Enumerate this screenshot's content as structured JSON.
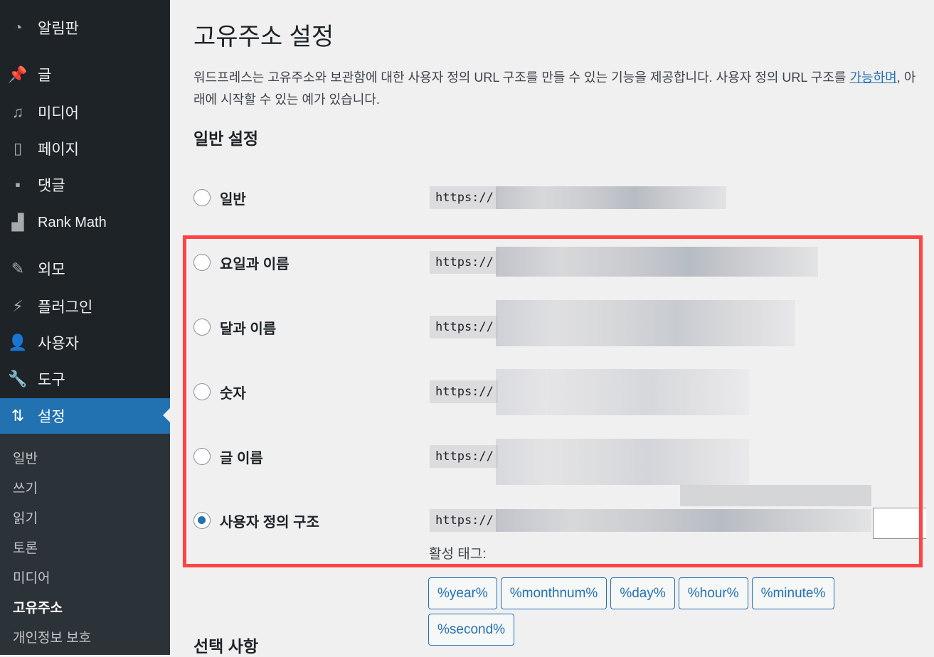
{
  "sidebar": {
    "items": [
      {
        "label": "알림판",
        "icon": "dashboard-icon"
      },
      {
        "label": "글",
        "icon": "pin-icon"
      },
      {
        "label": "미디어",
        "icon": "media-icon"
      },
      {
        "label": "페이지",
        "icon": "pages-icon"
      },
      {
        "label": "댓글",
        "icon": "comment-icon"
      },
      {
        "label": "Rank Math",
        "icon": "rank-math-icon"
      },
      {
        "label": "외모",
        "icon": "brush-icon"
      },
      {
        "label": "플러그인",
        "icon": "plugin-icon"
      },
      {
        "label": "사용자",
        "icon": "user-icon"
      },
      {
        "label": "도구",
        "icon": "wrench-icon"
      },
      {
        "label": "설정",
        "icon": "settings-icon",
        "active": true
      }
    ],
    "submenu": [
      "일반",
      "쓰기",
      "읽기",
      "토론",
      "미디어",
      "고유주소",
      "개인정보 보호"
    ],
    "submenu_current": "고유주소"
  },
  "page": {
    "title": "고유주소 설정",
    "desc1": "워드프레스는 고유주소와 보관함에 대한 사용자 정의 URL 구조를 만들 수 있는 기능을 제공합니다. 사용자 정의 URL 구조를",
    "desc_link": "가능하며",
    "desc2": ", 아래에 시작할 수 있는 예가 있습니다.",
    "section": "일반 설정",
    "section2": "선택 사항"
  },
  "options": [
    {
      "label": "일반",
      "prefix": "https://",
      "selected": false
    },
    {
      "label": "요일과 이름",
      "prefix": "https://",
      "selected": false
    },
    {
      "label": "달과 이름",
      "prefix": "https://",
      "selected": false
    },
    {
      "label": "숫자",
      "prefix": "https://",
      "selected": false
    },
    {
      "label": "글 이름",
      "prefix": "https://",
      "selected": false
    },
    {
      "label": "사용자 정의 구조",
      "prefix": "https://",
      "selected": true
    }
  ],
  "active_tags_label": "활성 태그:",
  "tags": [
    "%year%",
    "%monthnum%",
    "%day%",
    "%hour%",
    "%minute%",
    "%second%"
  ],
  "colors": {
    "accent": "#2271b1",
    "highlight_box": "#ff4444"
  }
}
